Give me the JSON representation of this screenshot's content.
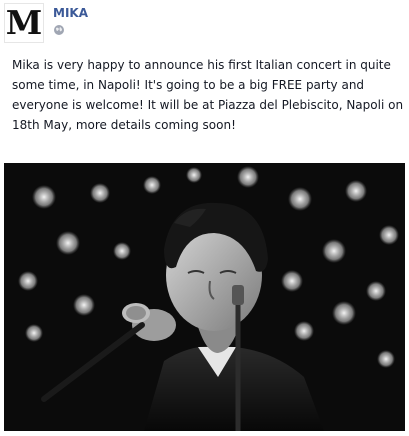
{
  "page": {
    "name": "MIKA",
    "logo_letter": "M",
    "privacy_icon": "globe-icon"
  },
  "post": {
    "message": "Mika is very happy to announce his first Italian concert in quite some time, in Napoli! It's going to be a big FREE party and everyone is welcome! It will be at Piazza del Plebiscito, Napoli on 18th May, more details coming soon!"
  },
  "colors": {
    "name_link": "#3b5998",
    "text": "#141823",
    "photo_bg": "#0b0b0b"
  }
}
